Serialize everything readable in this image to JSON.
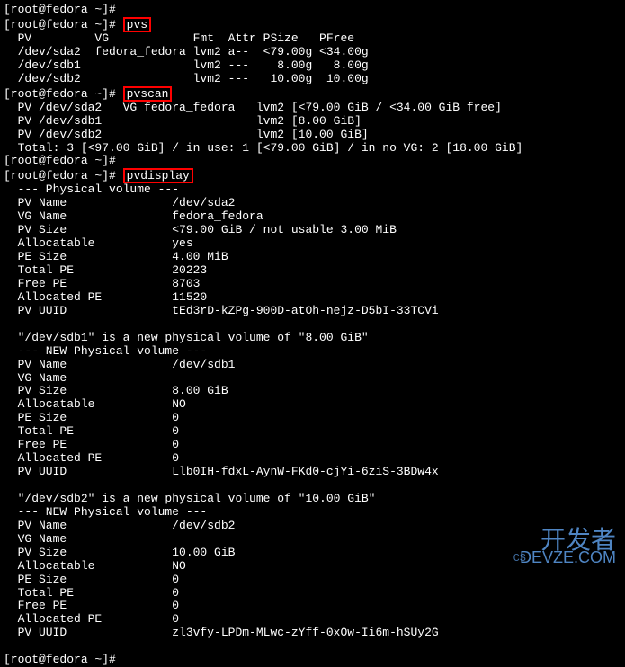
{
  "prompts": {
    "p1": "[root@fedora ~]",
    "p2": "# "
  },
  "commands": {
    "pvs": "pvs",
    "pvscan": "pvscan",
    "pvdisplay": "pvdisplay"
  },
  "pvs_output": {
    "header": "  PV         VG            Fmt  Attr PSize   PFree",
    "rows": [
      "  /dev/sda2  fedora_fedora lvm2 a--  <79.00g <34.00g",
      "  /dev/sdb1                lvm2 ---    8.00g   8.00g",
      "  /dev/sdb2                lvm2 ---   10.00g  10.00g"
    ]
  },
  "pvscan_output": [
    "  PV /dev/sda2   VG fedora_fedora   lvm2 [<79.00 GiB / <34.00 GiB free]",
    "  PV /dev/sdb1                      lvm2 [8.00 GiB]",
    "  PV /dev/sdb2                      lvm2 [10.00 GiB]",
    "  Total: 3 [<97.00 GiB] / in use: 1 [<79.00 GiB] / in no VG: 2 [18.00 GiB]"
  ],
  "empty_prompt": "[root@fedora ~]# ",
  "pvdisplay_output": {
    "pv1": {
      "header": "  --- Physical volume ---",
      "rows": [
        "  PV Name               /dev/sda2",
        "  VG Name               fedora_fedora",
        "  PV Size               <79.00 GiB / not usable 3.00 MiB",
        "  Allocatable           yes",
        "  PE Size               4.00 MiB",
        "  Total PE              20223",
        "  Free PE               8703",
        "  Allocated PE          11520",
        "  PV UUID               tEd3rD-kZPg-900D-atOh-nejz-D5bI-33TCVi"
      ]
    },
    "pv2": {
      "msg": "  \"/dev/sdb1\" is a new physical volume of \"8.00 GiB\"",
      "header": "  --- NEW Physical volume ---",
      "rows": [
        "  PV Name               /dev/sdb1",
        "  VG Name               ",
        "  PV Size               8.00 GiB",
        "  Allocatable           NO",
        "  PE Size               0",
        "  Total PE              0",
        "  Free PE               0",
        "  Allocated PE          0",
        "  PV UUID               Llb0IH-fdxL-AynW-FKd0-cjYi-6ziS-3BDw4x"
      ]
    },
    "pv3": {
      "msg": "  \"/dev/sdb2\" is a new physical volume of \"10.00 GiB\"",
      "header": "  --- NEW Physical volume ---",
      "rows": [
        "  PV Name               /dev/sdb2",
        "  VG Name               ",
        "  PV Size               10.00 GiB",
        "  Allocatable           NO",
        "  PE Size               0",
        "  Total PE              0",
        "  Free PE               0",
        "  Allocated PE          0",
        "  PV UUID               zl3vfy-LPDm-MLwc-zYff-0xOw-Ii6m-hSUy2G"
      ]
    }
  },
  "watermark": {
    "top": "开发者",
    "bottom": "DEVZE.COM",
    "csdn": "CS"
  }
}
